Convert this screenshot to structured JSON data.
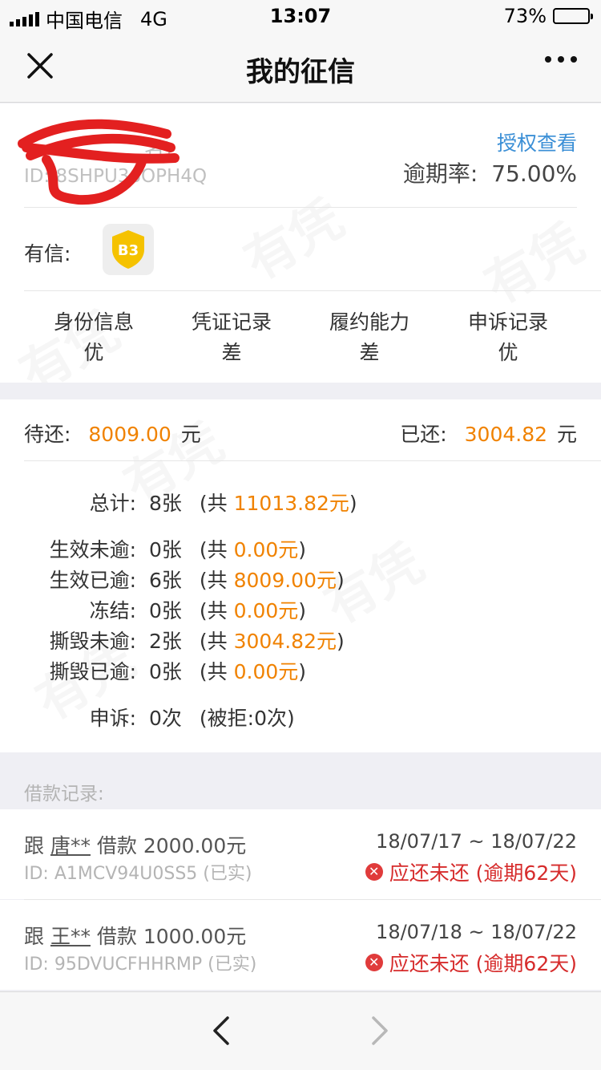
{
  "status_bar": {
    "carrier": "中国电信",
    "network": "4G",
    "time": "13:07",
    "battery": "73%",
    "battery_level": 0.73
  },
  "nav": {
    "title": "我的征信"
  },
  "profile": {
    "name_suffix": "名)",
    "id": "ID: 8SHPU36OPH4Q",
    "auth_link": "授权查看",
    "overdue_label": "逾期率:",
    "overdue_rate": "75.00%"
  },
  "credit": {
    "label": "有信:",
    "grade": "B3"
  },
  "stats": [
    {
      "label": "身份信息",
      "value": "优"
    },
    {
      "label": "凭证记录",
      "value": "差"
    },
    {
      "label": "履约能力",
      "value": "差"
    },
    {
      "label": "申诉记录",
      "value": "优"
    }
  ],
  "summary": {
    "pending_label": "待还:",
    "pending": "8009.00",
    "unit": "元",
    "paid_label": "已还:",
    "paid": "3004.82"
  },
  "details": [
    {
      "label": "总计:",
      "count": "8张",
      "prefix": "(共 ",
      "amount": "11013.82元",
      "suffix": ")"
    },
    {
      "label": "生效未逾:",
      "count": "0张",
      "prefix": "(共 ",
      "amount": "0.00元",
      "suffix": ")"
    },
    {
      "label": "生效已逾:",
      "count": "6张",
      "prefix": "(共 ",
      "amount": "8009.00元",
      "suffix": ")"
    },
    {
      "label": "冻结:",
      "count": "0张",
      "prefix": "(共 ",
      "amount": "0.00元",
      "suffix": ")"
    },
    {
      "label": "撕毁未逾:",
      "count": "2张",
      "prefix": "(共 ",
      "amount": "3004.82元",
      "suffix": ")"
    },
    {
      "label": "撕毁已逾:",
      "count": "0张",
      "prefix": "(共 ",
      "amount": "0.00元",
      "suffix": ")"
    }
  ],
  "appeal": {
    "label": "申诉:",
    "count": "0次",
    "rejected": "(被拒:0次)"
  },
  "loans_header": "借款记录:",
  "loans": [
    {
      "prefix": "跟 ",
      "person": "唐**",
      "amount": " 借款 2000.00元",
      "id": "ID: A1MCV94U0SS5 (已实)",
      "dates": "18/07/17 ~ 18/07/22",
      "status": "应还未还 (逾期62天)"
    },
    {
      "prefix": "跟 ",
      "person": "王**",
      "amount": " 借款 1000.00元",
      "id": "ID: 95DVUCFHHRMP (已实)",
      "dates": "18/07/18 ~ 18/07/22",
      "status": "应还未还 (逾期62天)"
    }
  ],
  "watermark": "有凭"
}
